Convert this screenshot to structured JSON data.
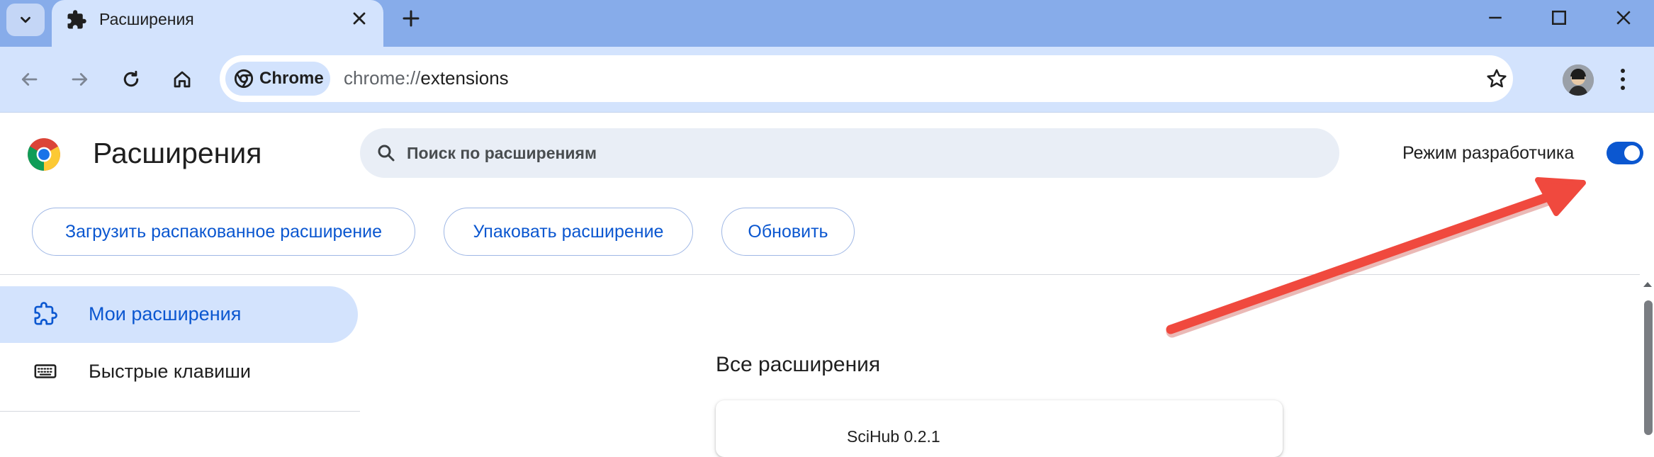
{
  "browser": {
    "tab_title": "Расширения",
    "chip_label": "Chrome",
    "url_scheme": "chrome://",
    "url_path": "extensions"
  },
  "page": {
    "title": "Расширения",
    "search_placeholder": "Поиск по расширениям",
    "dev_mode_label": "Режим разработчика",
    "dev_mode_enabled": true
  },
  "actions": {
    "load_unpacked": "Загрузить распакованное расширение",
    "pack": "Упаковать расширение",
    "update": "Обновить"
  },
  "sidebar": {
    "items": [
      {
        "label": "Мои расширения",
        "active": true
      },
      {
        "label": "Быстрые клавиши",
        "active": false
      }
    ]
  },
  "main": {
    "section_title": "Все расширения",
    "first_extension_partial": "SciHub 0.2.1"
  },
  "colors": {
    "accent": "#0b57d0",
    "tab_strip": "#87acea",
    "toolbar": "#d3e3fd",
    "annotation": "#f0493e"
  },
  "icons": [
    "tab-search-icon",
    "puzzle-icon",
    "close-icon",
    "plus-icon",
    "minimize-icon",
    "maximize-icon",
    "window-close-icon",
    "back-icon",
    "forward-icon",
    "reload-icon",
    "home-icon",
    "chrome-icon",
    "star-icon",
    "avatar",
    "kebab-icon",
    "chrome-logo",
    "search-icon",
    "extensions-icon",
    "keyboard-icon"
  ]
}
